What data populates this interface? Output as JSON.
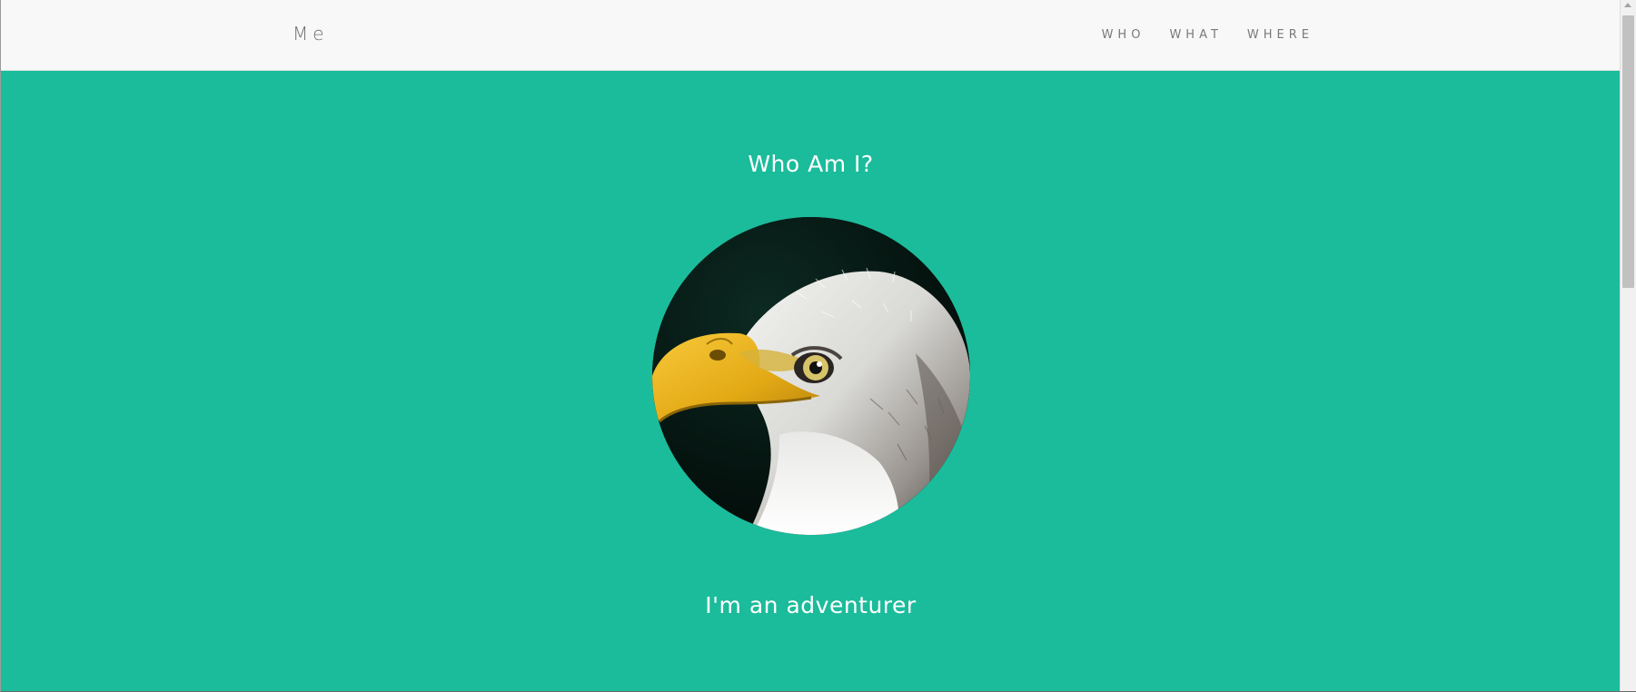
{
  "navbar": {
    "brand": "Me",
    "links": [
      {
        "label": "WHO"
      },
      {
        "label": "WHAT"
      },
      {
        "label": "WHERE"
      }
    ]
  },
  "hero": {
    "title": "Who Am I?",
    "avatar_icon": "eagle-portrait-image",
    "subtitle": "I'm an adventurer"
  },
  "colors": {
    "accent": "#1bbc9b",
    "navbar_bg": "#f8f8f8",
    "nav_text": "#7a7a7a",
    "hero_text": "#ffffff"
  }
}
